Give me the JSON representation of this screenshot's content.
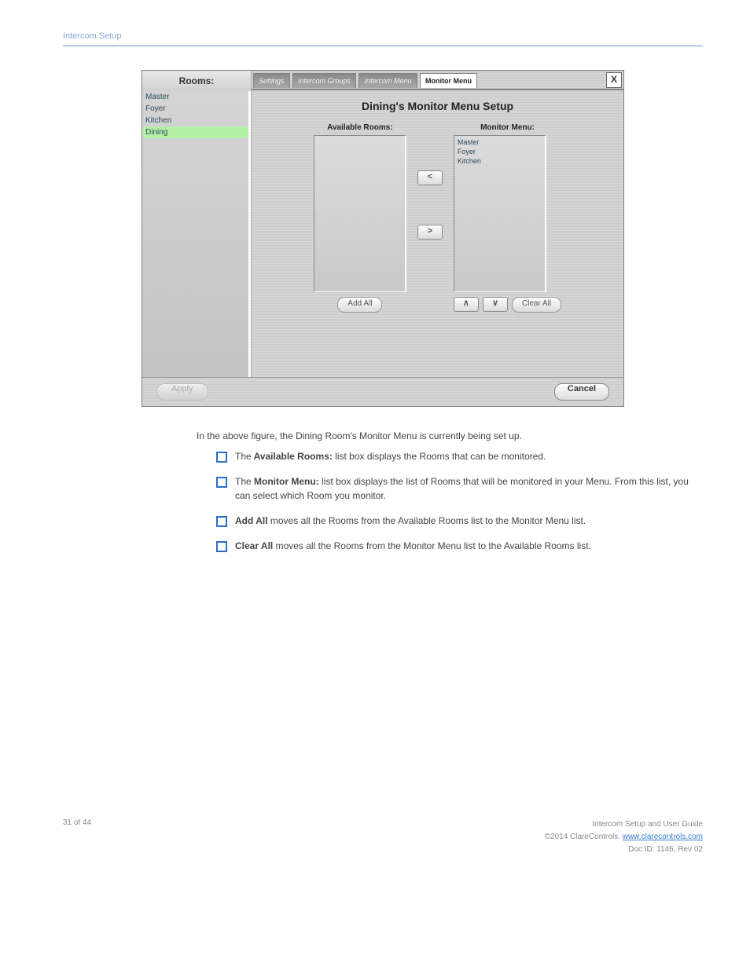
{
  "doc_title": "Intercom Setup",
  "window": {
    "close": "X",
    "sidebar": {
      "title": "Rooms:",
      "items": [
        "Master",
        "Foyer",
        "Kitchen",
        "Dining"
      ],
      "selected_index": 3
    },
    "tabs": [
      {
        "label": "Settings",
        "active": false
      },
      {
        "label": "Intercom Groups",
        "active": false
      },
      {
        "label": "Intercom Menu",
        "active": false
      },
      {
        "label": "Monitor Menu",
        "active": true
      }
    ],
    "panel_title": "Dining's Monitor Menu Setup",
    "available_label": "Available Rooms:",
    "available_items": [],
    "monitor_label": "Monitor Menu:",
    "monitor_items": [
      "Master",
      "Foyer",
      "Kitchen"
    ],
    "btn_move_left": "<",
    "btn_move_right": ">",
    "btn_add_all": "Add All",
    "btn_up": "∧",
    "btn_down": "∨",
    "btn_clear_all": "Clear All",
    "btn_apply": "Apply",
    "btn_cancel": "Cancel"
  },
  "desc_text": "In the above figure, the Dining Room's Monitor Menu is currently being set up.",
  "bullets": [
    {
      "prefix": "The",
      "bold": " Available Rooms: ",
      "rest": "list box displays the Rooms that can be monitored."
    },
    {
      "prefix": "The",
      "bold": " Monitor Menu: ",
      "rest": "list box displays the list of Rooms that will be monitored in your Menu. From this list, you can select which Room you monitor."
    },
    {
      "prefix": "",
      "bold": "Add All ",
      "rest": "moves all the Rooms from the Available Rooms list to the Monitor Menu list."
    },
    {
      "prefix": "",
      "bold": "Clear All ",
      "rest": "moves all the Rooms from the Monitor Menu list to the Available Rooms list."
    }
  ],
  "footer": {
    "page": "31 of 44",
    "line1": "Intercom Setup and User Guide",
    "line2_a": "©2014 ClareControls.",
    "line2_b": "www.clarecontrols.com",
    "line3": "Doc ID: 1146, Rev 02"
  }
}
